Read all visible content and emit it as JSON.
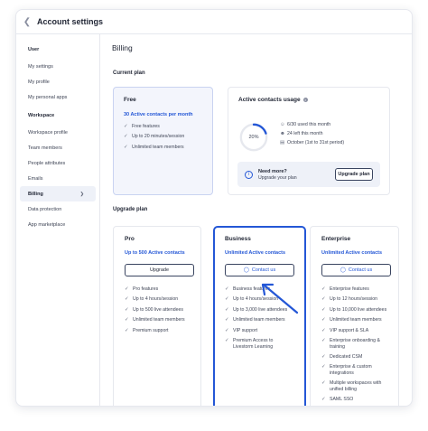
{
  "window": {
    "title": "Account settings"
  },
  "sidebar": {
    "user_label": "User",
    "user_items": [
      "My settings",
      "My profile",
      "My personal apps"
    ],
    "workspace_label": "Workspace",
    "workspace_items": [
      "Workspace profile",
      "Team members",
      "People attributes",
      "Emails",
      "Billing",
      "Data protection",
      "App marketplace"
    ],
    "active_item": "Billing"
  },
  "main": {
    "heading": "Billing",
    "current_plan_label": "Current plan",
    "upgrade_plan_label": "Upgrade plan"
  },
  "current_plan": {
    "name": "Free",
    "contacts": "30 Active contacts per month",
    "features": [
      "Free features",
      "Up to 20 minutes/session",
      "Unlimited team members"
    ]
  },
  "usage": {
    "title": "Active contacts usage",
    "percent_label": "20%",
    "percent": 20,
    "used": "6/30 used this month",
    "left": "24 left this month",
    "period": "October (1st to 31st period)",
    "need_more_title": "Need more?",
    "need_more_sub": "Upgrade your plan",
    "upgrade_button": "Upgrade plan"
  },
  "plans": {
    "pro": {
      "name": "Pro",
      "contacts": "Up to 500 Active contacts",
      "button": "Upgrade",
      "features": [
        "Pro features",
        "Up to 4 hours/session",
        "Up to 500 live attendees",
        "Unlimited team members",
        "Premium support"
      ]
    },
    "business": {
      "name": "Business",
      "contacts": "Unlimited Active contacts",
      "button": "Contact us",
      "features": [
        "Business features",
        "Up to 4 hours/session",
        "Up to 3,000 live attendees",
        "Unlimited team members",
        "VIP support",
        "Premium Access to Livestorm Learning"
      ]
    },
    "enterprise": {
      "name": "Enterprise",
      "contacts": "Unlimited Active contacts",
      "button": "Contact us",
      "features": [
        "Enterprise features",
        "Up to 12 hours/session",
        "Up to 10,000 live attendees",
        "Unlimited team members",
        "VIP support & SLA",
        "Enterprise onboarding & training",
        "Dedicated CSM",
        "Enterprise & custom integrations",
        "Multiple workspaces with unified billing",
        "SAML SSO"
      ]
    }
  },
  "colors": {
    "accent": "#2457d6",
    "ring_track": "#e6e8ee"
  }
}
